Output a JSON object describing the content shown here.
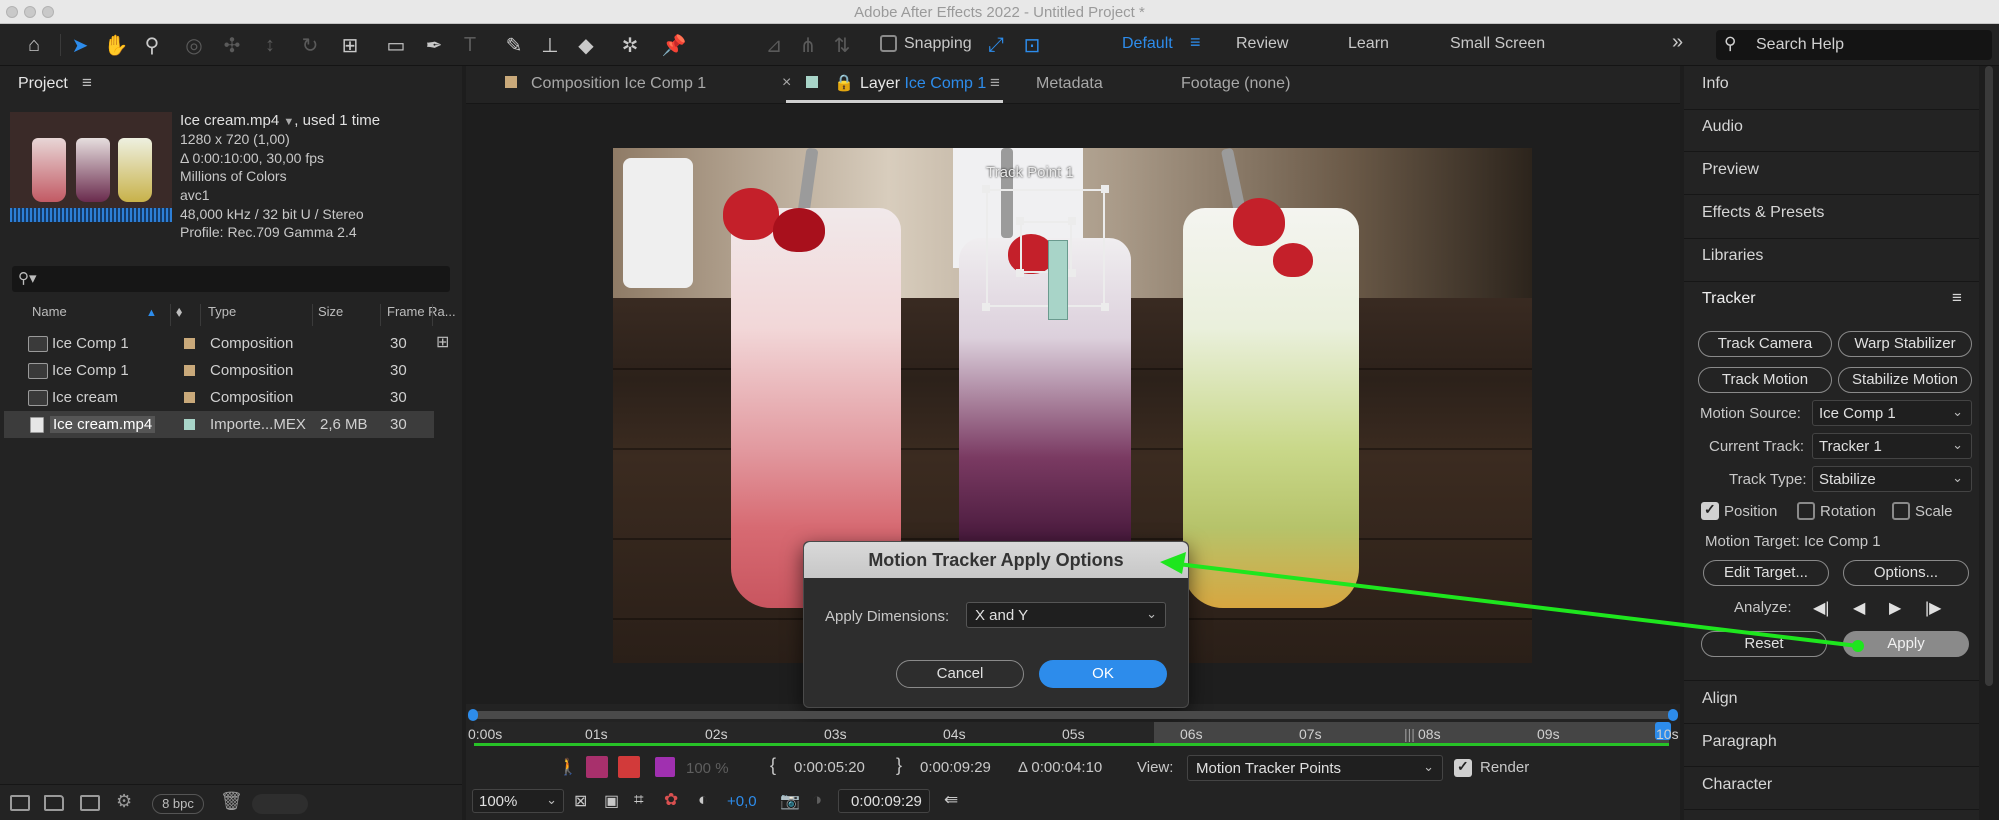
{
  "window": {
    "title": "Adobe After Effects 2022 - Untitled Project *"
  },
  "toolbar": {
    "snapping_label": "Snapping",
    "workspaces": [
      "Default",
      "Review",
      "Learn",
      "Small Screen"
    ],
    "active_workspace": "Default",
    "search_placeholder": "Search Help"
  },
  "project": {
    "title": "Project",
    "file_name": "Ice cream.mp4",
    "used": ", used 1 time",
    "info": [
      "1280 x 720 (1,00)",
      "Δ 0:00:10:00, 30,00 fps",
      "Millions of Colors",
      "avc1",
      "48,000 kHz / 32 bit U / Stereo",
      "Profile: Rec.709 Gamma 2.4"
    ],
    "columns": [
      "Name",
      "Type",
      "Size",
      "Frame Ra..."
    ],
    "rows": [
      {
        "name": "Ice Comp 1",
        "type": "Composition",
        "size": "",
        "fps": "30",
        "color": "#c9a97a"
      },
      {
        "name": "Ice Comp 1",
        "type": "Composition",
        "size": "",
        "fps": "30",
        "color": "#c9a97a"
      },
      {
        "name": "Ice cream",
        "type": "Composition",
        "size": "",
        "fps": "30",
        "color": "#c9a97a"
      },
      {
        "name": "Ice cream.mp4",
        "type": "Importe...MEX",
        "size": "2,6 MB",
        "fps": "30",
        "color": "#a8d4c8"
      }
    ],
    "bpc": "8 bpc"
  },
  "viewer": {
    "tabs": {
      "composition_prefix": "Composition",
      "composition_name": "Ice Comp 1",
      "layer_prefix": "Layer",
      "layer_name": "Ice Comp 1",
      "metadata": "Metadata",
      "footage": "Footage (none)"
    },
    "track_point_label": "Track Point 1",
    "timeline_labels": [
      "0:00s",
      "01s",
      "02s",
      "03s",
      "04s",
      "05s",
      "06s",
      "07s",
      "08s",
      "09s",
      "10s"
    ],
    "in_time": "0:00:05:20",
    "out_time": "0:00:09:29",
    "duration": "Δ 0:00:04:10",
    "view_label": "View:",
    "view_value": "Motion Tracker Points",
    "render_label": "Render",
    "zoom": "100%",
    "exposure": "+0,0",
    "current_time": "0:00:09:29",
    "opacity": "100 %"
  },
  "dialog": {
    "title": "Motion Tracker Apply Options",
    "label": "Apply Dimensions:",
    "value": "X and Y",
    "cancel": "Cancel",
    "ok": "OK"
  },
  "right_panel": {
    "sections_top": [
      "Info",
      "Audio",
      "Preview",
      "Effects & Presets",
      "Libraries"
    ],
    "tracker_title": "Tracker",
    "track_camera": "Track Camera",
    "warp_stabilizer": "Warp Stabilizer",
    "track_motion": "Track Motion",
    "stabilize_motion": "Stabilize Motion",
    "motion_source_label": "Motion Source:",
    "motion_source_value": "Ice Comp 1",
    "current_track_label": "Current Track:",
    "current_track_value": "Tracker 1",
    "track_type_label": "Track Type:",
    "track_type_value": "Stabilize",
    "position_label": "Position",
    "rotation_label": "Rotation",
    "scale_label": "Scale",
    "motion_target": "Motion Target: Ice Comp 1",
    "edit_target": "Edit Target...",
    "options": "Options...",
    "analyze_label": "Analyze:",
    "reset": "Reset",
    "apply": "Apply",
    "sections_bottom": [
      "Align",
      "Paragraph",
      "Character"
    ]
  },
  "colors": {
    "accent": "#2d8ceb",
    "annotation_arrow": "#1ee61e"
  }
}
